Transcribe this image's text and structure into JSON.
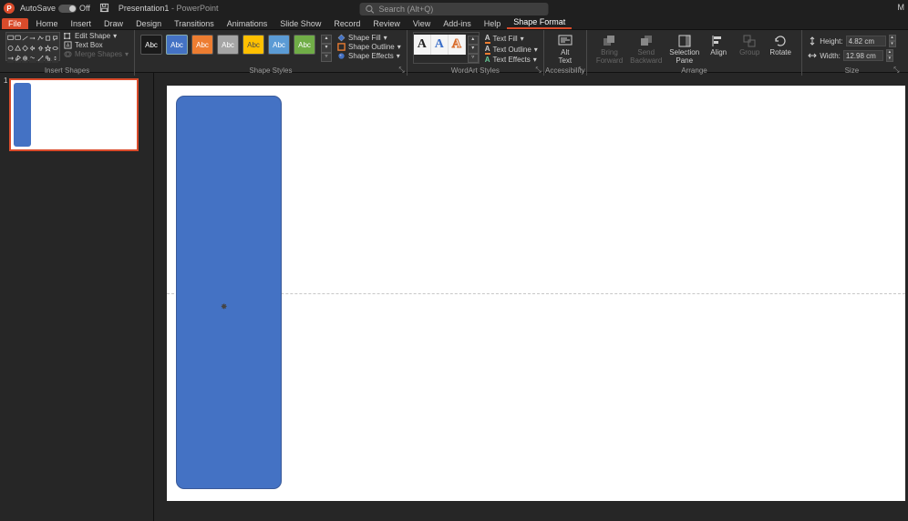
{
  "title": {
    "doc": "Presentation1",
    "app": "PowerPoint",
    "autosave": "AutoSave",
    "autosave_state": "Off"
  },
  "search": {
    "placeholder": "Search (Alt+Q)"
  },
  "user": {
    "name": "M"
  },
  "tabs": [
    "File",
    "Home",
    "Insert",
    "Draw",
    "Design",
    "Transitions",
    "Animations",
    "Slide Show",
    "Record",
    "Review",
    "View",
    "Add-ins",
    "Help",
    "Shape Format"
  ],
  "active_tab": "Shape Format",
  "groups": {
    "insert_shapes": "Insert Shapes",
    "shape_styles": "Shape Styles",
    "wordart_styles": "WordArt Styles",
    "accessibility": "Accessibility",
    "arrange": "Arrange",
    "size": "Size"
  },
  "insert_shapes_tools": {
    "edit": "Edit Shape",
    "textbox": "Text Box",
    "merge": "Merge Shapes"
  },
  "style_swatches": [
    {
      "bg": "#1a1a1a",
      "fg": "#ffffff",
      "label": "Abc"
    },
    {
      "bg": "#4472c4",
      "fg": "#ffffff",
      "label": "Abc"
    },
    {
      "bg": "#ed7d31",
      "fg": "#ffffff",
      "label": "Abc"
    },
    {
      "bg": "#a5a5a5",
      "fg": "#ffffff",
      "label": "Abc"
    },
    {
      "bg": "#ffc000",
      "fg": "#4a4a4a",
      "label": "Abc"
    },
    {
      "bg": "#5b9bd5",
      "fg": "#ffffff",
      "label": "Abc"
    },
    {
      "bg": "#70ad47",
      "fg": "#ffffff",
      "label": "Abc"
    }
  ],
  "fill_menu": {
    "fill": "Shape Fill",
    "outline": "Shape Outline",
    "effects": "Shape Effects"
  },
  "wordart": [
    {
      "color": "#222222",
      "label": "A"
    },
    {
      "color": "#3b6fc9",
      "label": "A"
    },
    {
      "color": "#d86b2a",
      "label": "A",
      "outline": true
    }
  ],
  "text_menu": {
    "fill": "Text Fill",
    "outline": "Text Outline",
    "effects": "Text Effects"
  },
  "accessibility_btn": {
    "l1": "Alt",
    "l2": "Text"
  },
  "arrange": {
    "bring_forward": {
      "l1": "Bring",
      "l2": "Forward"
    },
    "send_backward": {
      "l1": "Send",
      "l2": "Backward"
    },
    "selection_pane": {
      "l1": "Selection",
      "l2": "Pane"
    },
    "align": "Align",
    "group": "Group",
    "rotate": "Rotate"
  },
  "size": {
    "height_label": "Height:",
    "height": "4.82 cm",
    "width_label": "Width:",
    "width": "12.98 cm"
  },
  "slide": {
    "number": "1",
    "shape_color": "#4472c4"
  }
}
